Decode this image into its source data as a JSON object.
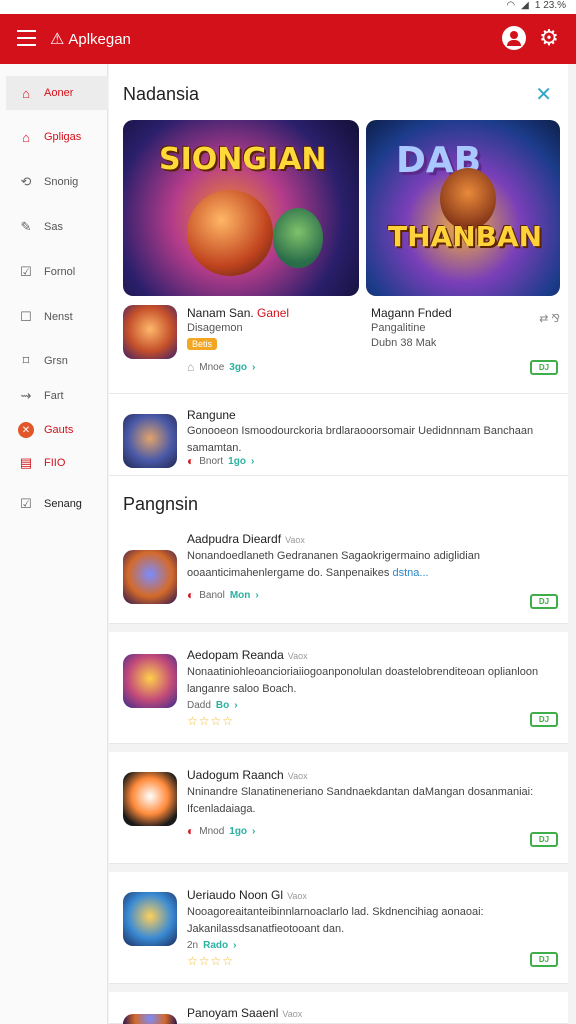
{
  "status": {
    "time": "1 23.%"
  },
  "appbar": {
    "brand": "Aplkegan",
    "logo_icon": "android-logo-icon",
    "color": "#d3111a"
  },
  "sidebar": {
    "items": [
      {
        "label": "Aoner",
        "icon": "⌂"
      },
      {
        "label": "Gpligas",
        "icon": "⌂"
      },
      {
        "label": "Snonig",
        "icon": "⟲"
      },
      {
        "label": "Sas",
        "icon": "✎"
      },
      {
        "label": "Fornol",
        "icon": "☑"
      },
      {
        "label": "Nenst",
        "icon": "☐"
      },
      {
        "label": "Grsn",
        "icon": "⌑"
      },
      {
        "label": "Fart",
        "icon": "⇝"
      },
      {
        "label": "Gauts",
        "icon": "✕"
      },
      {
        "label": "FIIO",
        "icon": "▤"
      },
      {
        "label": "Senang",
        "icon": "☑"
      }
    ]
  },
  "featured": {
    "heading": "Nadansia",
    "banners": [
      {
        "title": "SIONGIAN"
      },
      {
        "title_a": "DAB",
        "title_b": "THANBAN"
      }
    ],
    "apps": [
      {
        "title": "Nanam San.",
        "title_red": "Ganel",
        "sub": "Disagemon",
        "badge": "Betis",
        "meta_label": "Mnoe",
        "meta_num": "3go"
      },
      {
        "title": "Magann Fnded",
        "sub": "Pangalitine",
        "sub2": "Dubn 38 Mak",
        "dl": "DJ"
      }
    ]
  },
  "featured_row": {
    "title": "Rangune",
    "desc": "Gonooeon Ismoodourckoria brdlaraooorsomair Uedidnnnam Banchaan samamtan.",
    "meta_label": "Bnort",
    "meta_num": "1go"
  },
  "section": {
    "heading": "Pangnsin",
    "items": [
      {
        "title": "Aadpudra Dieardf",
        "tag": "Vaox",
        "desc": "Nonandoedlaneth Gedrananen Sagaokrigermaino adiglidian ooaanticimahenlergame do. Sanpenaikes",
        "link": "dstna...",
        "meta_label": "Banol",
        "meta_num": "Mon",
        "dl": "DJ"
      },
      {
        "title": "Aedopam Reanda",
        "tag": "Vaox",
        "desc": "Nonaatiniohleoancioriaiiogoanponolulan doastelobrenditeoan oplianloon langanre saloo Boach.",
        "meta_label": "Dadd",
        "meta_num": "Bo",
        "stars": "☆☆☆☆",
        "dl": "DJ"
      },
      {
        "title": "Uadogum Raanch",
        "tag": "Vaox",
        "desc": "Nninandre Slanatineneriano Sandnaekdantan daMangan dosanmaniai: Ifcenladaiaga.",
        "meta_label": "Mnod",
        "meta_num": "1go",
        "dl": "DJ"
      },
      {
        "title": "Ueriaudo Noon Gl",
        "tag": "Vaox",
        "desc": "Nooagoreaitanteibinnlarnoaclarlo lad. Skdnencihiag aonaoai: Jakanilassdsanatfieotooant dan.",
        "meta_label": "2n",
        "meta_num": "Rado",
        "stars": "☆☆☆☆",
        "dl": "DJ"
      },
      {
        "title": "Panoyam Saaenl",
        "tag": "Vaox"
      }
    ]
  }
}
